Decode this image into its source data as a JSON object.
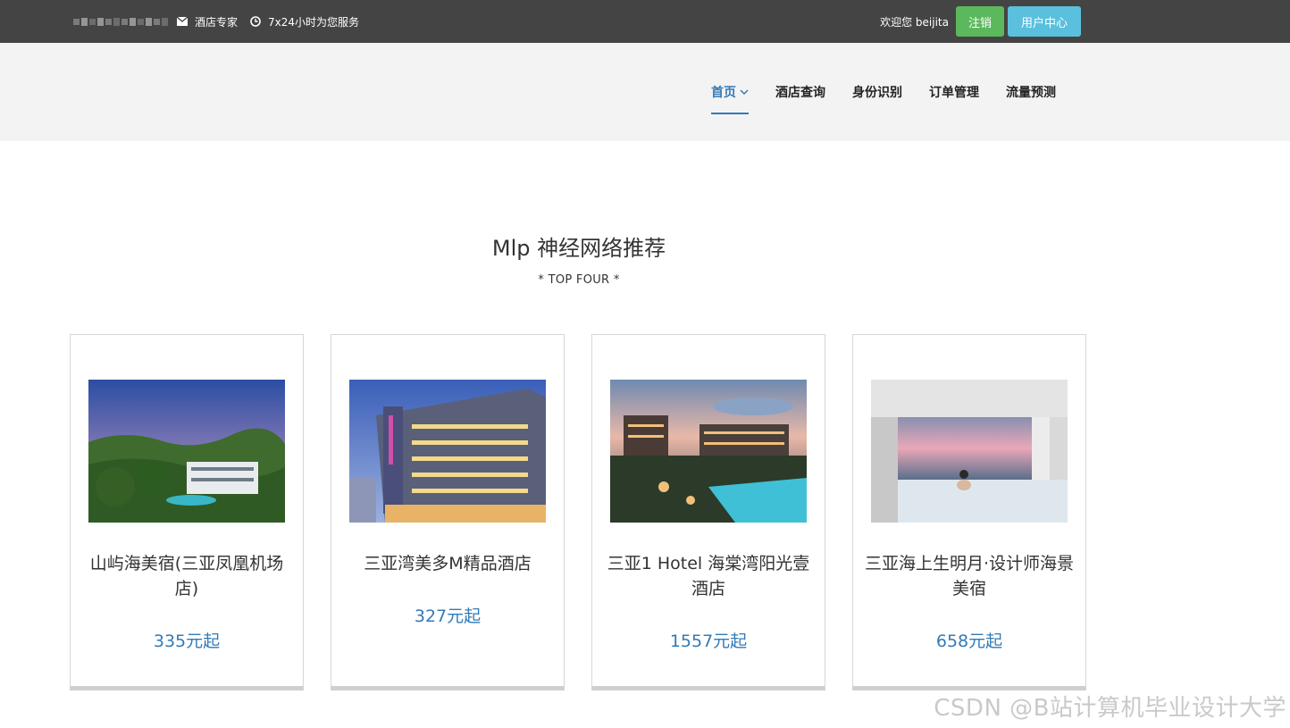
{
  "topbar": {
    "item_expert": "酒店专家",
    "item_service": "7x24小时为您服务",
    "welcome": "欢迎您 beijita",
    "logout_label": "注销",
    "user_center_label": "用户中心",
    "mail_icon": "mail-icon",
    "clock_icon": "clock-icon"
  },
  "nav": {
    "items": [
      {
        "label": "首页"
      },
      {
        "label": "酒店查询"
      },
      {
        "label": "身份识别"
      },
      {
        "label": "订单管理"
      },
      {
        "label": "流量预测"
      }
    ]
  },
  "section": {
    "title": "Mlp 神经网络推荐",
    "subtitle": "* TOP FOUR *"
  },
  "hotels": [
    {
      "name": "山屿海美宿(三亚凤凰机场店)",
      "price": "335元起"
    },
    {
      "name": "三亚湾美多M精品酒店",
      "price": "327元起"
    },
    {
      "name": "三亚1 Hotel 海棠湾阳光壹酒店",
      "price": "1557元起"
    },
    {
      "name": "三亚海上生明月·设计师海景美宿",
      "price": "658元起"
    }
  ],
  "watermark": "CSDN @B站计算机毕业设计大学",
  "colors": {
    "topbar_bg": "#444444",
    "nav_bg": "#f3f3f3",
    "accent": "#337ab7",
    "logout_btn": "#5cb85c",
    "user_center_btn": "#5bc0de"
  }
}
